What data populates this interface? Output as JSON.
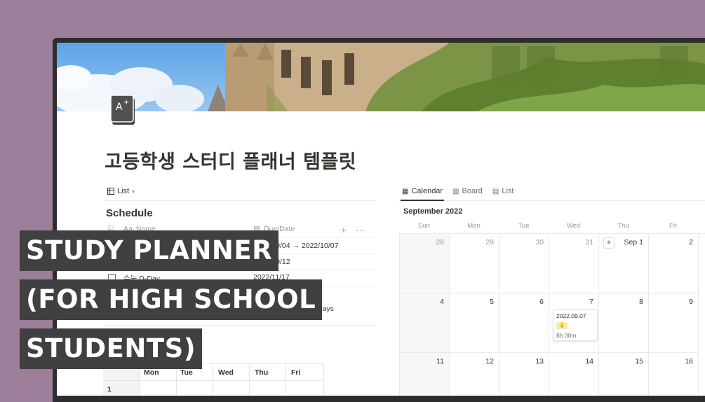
{
  "page": {
    "title": "고등학생 스터디 플래너 템플릿",
    "view_switch_label": "List"
  },
  "schedule": {
    "title": "Schedule",
    "columns": [
      "Name",
      "Due/Date"
    ],
    "rows": [
      {
        "name": "",
        "date": "2022/10/04 → 2022/10/07"
      },
      {
        "name": "",
        "date": "2022/10/12"
      },
      {
        "name": "수능 D-Day",
        "date": "2022/11/17"
      }
    ],
    "dday_value": "5 days"
  },
  "weekly": {
    "headers": [
      "Mon",
      "Tue",
      "Wed",
      "Thu",
      "Fri"
    ],
    "row_label": "1"
  },
  "calendar": {
    "tabs": [
      "Calendar",
      "Board",
      "List"
    ],
    "active_tab": "Calendar",
    "month": "September 2022",
    "days_of_week": [
      "Sun",
      "Mon",
      "Tue",
      "Wed",
      "Thu",
      "Fri"
    ],
    "weeks": [
      [
        "28",
        "29",
        "30",
        "31",
        "Sep 1",
        "2"
      ],
      [
        "4",
        "5",
        "6",
        "7",
        "8",
        "9"
      ],
      [
        "11",
        "12",
        "13",
        "14",
        "15",
        "16"
      ]
    ],
    "event": {
      "title": "2022.09.07",
      "tag": "💡",
      "duration": "8h 30m"
    }
  },
  "caption": {
    "line1": "STUDY PLANNER",
    "line2": "(FOR HIGH SCHOOL",
    "line3": "STUDENTS)"
  },
  "colors": {
    "background": "#9e7f9b",
    "caption_bg": "#404040",
    "text": "#37352f"
  }
}
